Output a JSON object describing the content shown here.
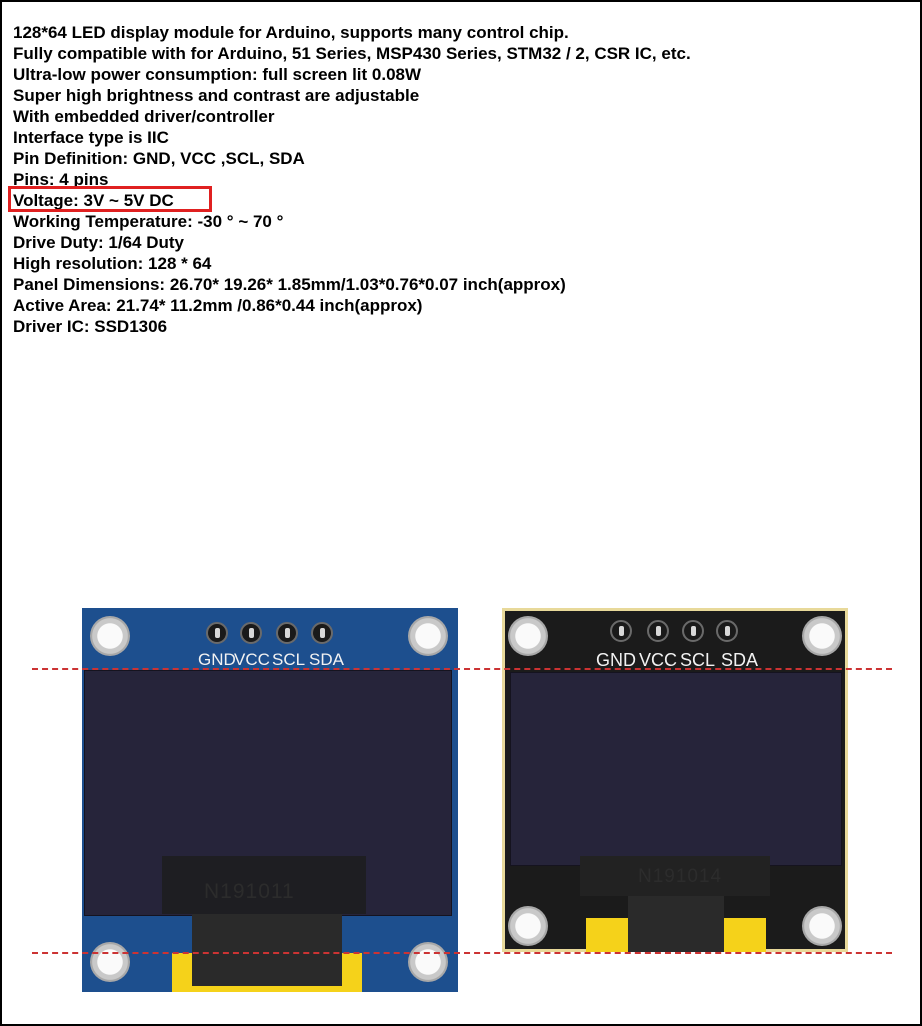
{
  "specs": [
    "128*64 LED display module for Arduino, supports many control chip.",
    "Fully compatible with for Arduino, 51 Series, MSP430 Series, STM32 / 2, CSR IC, etc.",
    "Ultra-low power consumption: full screen lit 0.08W",
    "Super high brightness and contrast are adjustable",
    "With embedded driver/controller",
    "Interface type is IIC",
    "Pin Definition: GND, VCC ,SCL, SDA",
    "Pins: 4 pins",
    "Voltage: 3V ~ 5V DC",
    "Working Temperature: -30 ° ~ 70 °",
    "Drive Duty: 1/64 Duty",
    "High resolution: 128 * 64",
    "Panel Dimensions: 26.70* 19.26* 1.85mm/1.03*0.76*0.07 inch(approx)",
    "Active Area: 21.74* 11.2mm /0.86*0.44 inch(approx)",
    "Driver IC: SSD1306"
  ],
  "highlighted_spec_index": 8,
  "modules": [
    {
      "color_name": "blue",
      "pcb_color": "#1d4f8e",
      "pin_labels": [
        "GND",
        "VCC",
        "SCL",
        "SDA"
      ],
      "chip_marking": "N191011"
    },
    {
      "color_name": "black",
      "pcb_color": "#1b1b1b",
      "pin_labels": [
        "GND",
        "VCC",
        "SCL",
        "SDA"
      ],
      "chip_marking": "N191014"
    }
  ],
  "colors": {
    "highlight": "#e02020",
    "guide_line": "#cc3333",
    "screen": "#26243a",
    "connector_tape": "#f5d21a"
  }
}
